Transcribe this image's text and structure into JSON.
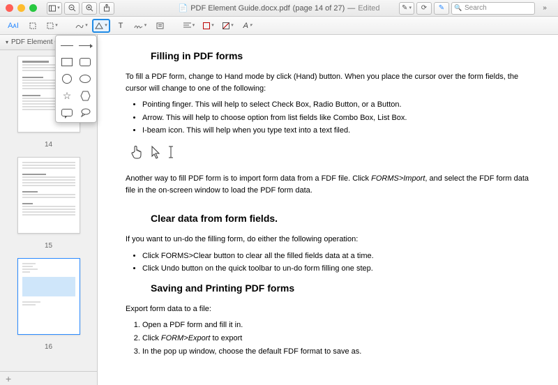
{
  "window": {
    "title_prefix": "PDF Element Guide.docx.pdf",
    "page_info": "(page 14 of 27)",
    "edited": "Edited",
    "search_placeholder": "Search"
  },
  "sidebar": {
    "tab_label": "PDF Element Guide",
    "thumbs": [
      {
        "label": "14"
      },
      {
        "label": "15"
      },
      {
        "label": "16"
      }
    ]
  },
  "content": {
    "h1": "Filling in PDF forms",
    "p1a": "To fill a PDF form, change to Hand mode by click (Hand) button. When you place the cursor over the form fields, the cursor will change to one of the following:",
    "b1": "Pointing finger. This will help to select Check Box, Radio Button, or a Button.",
    "b2": "Arrow. This will help to choose option from list fields like Combo Box, List Box.",
    "b3": "I-beam icon. This will help when you type text into a text filed.",
    "p2a": "Another way to fill PDF form is to import form data from a FDF file. Click ",
    "p2b": "FORMS>Import",
    "p2c": ", and select the FDF form data file in the on-screen window to load the PDF form data.",
    "h2": "Clear data from form fields.",
    "p3": "If you want to un-do the filling form, do either the following operation:",
    "b4": "Click FORMS>Clear button to clear all the filled fields data at a time.",
    "b5": "Click Undo button on the quick toolbar to un-do form filling one step.",
    "h3": "Saving and Printing PDF forms",
    "p4": "Export form data to a file:",
    "n1": "Open a PDF form and fill it in.",
    "n2a": "Click ",
    "n2b": "FORM>Export",
    "n2c": " to export",
    "n3": "In the pop up window, choose the default FDF format to save as."
  },
  "icons": {
    "aa": "AᴀI",
    "text_t": "T",
    "text_tu": "T",
    "a_style": "A"
  }
}
